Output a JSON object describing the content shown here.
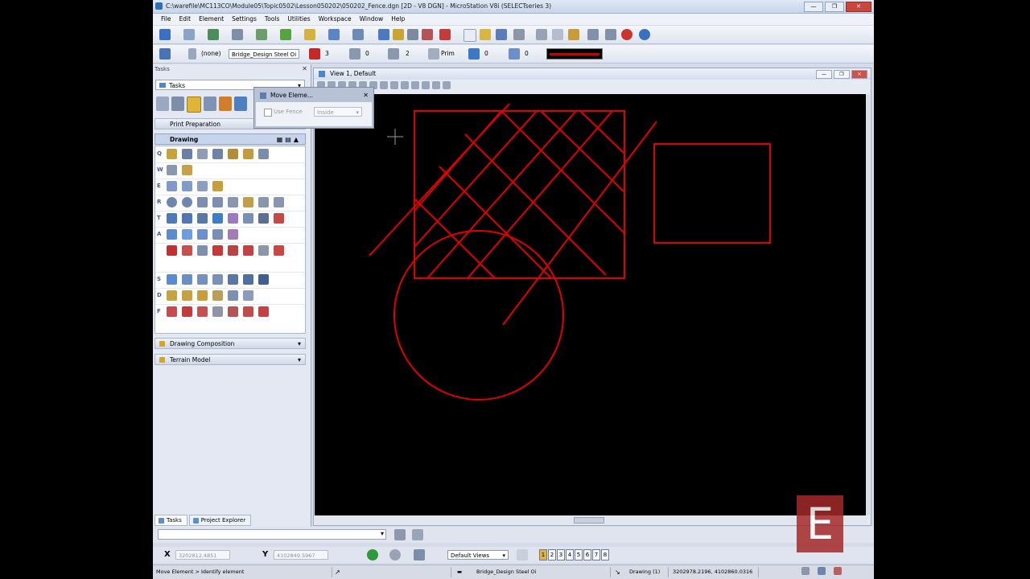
{
  "window": {
    "title": "C:\\warefile\\MC113CO\\Module05\\Topic0502\\Lesson050202\\050202_Fence.dgn [2D - V8 DGN] - MicroStation V8i (SELECTseries 3)",
    "minimize": "—",
    "maximize": "❐",
    "close": "✕"
  },
  "menu": [
    "File",
    "Edit",
    "Element",
    "Settings",
    "Tools",
    "Utilities",
    "Workspace",
    "Window",
    "Help"
  ],
  "attributes": {
    "linestyle": "(none)",
    "level": "Bridge_Design Steel Oi",
    "color": "3",
    "weight_style": "0",
    "weight": "2",
    "class": "Prim",
    "transparency": "0",
    "priority": "0",
    "active_color_hex": "#cc0000"
  },
  "panel": {
    "header": "Tasks",
    "pin": "⊞",
    "close": "✕",
    "task_selector": "Tasks",
    "print_preparation": "Print Preparation",
    "drawing": "Drawing",
    "drawing_composition": "Drawing Composition",
    "terrain_model": "Terrain Model",
    "row_letters": [
      "Q",
      "W",
      "E",
      "R",
      "T",
      "A",
      "",
      "S",
      "D",
      "F"
    ],
    "tab_tasks": "Tasks",
    "tab_explorer": "Project Explorer"
  },
  "view": {
    "title": "View 1, Default",
    "min": "—",
    "max": "❐",
    "close": "✕",
    "background": "#000000",
    "element_color": "#e00000"
  },
  "tool_settings": {
    "title": "Move Eleme...",
    "close": "✕",
    "use_fence_label": "Use Fence",
    "fence_mode": "Inside"
  },
  "coords": {
    "x_label": "X",
    "x_value": "3202812.4851",
    "y_label": "Y",
    "y_value": "4102849.5967",
    "views_dropdown": "Default Views",
    "view_numbers": [
      "1",
      "2",
      "3",
      "4",
      "5",
      "6",
      "7",
      "8"
    ]
  },
  "status": {
    "prompt": "Move Element > Identify element",
    "level": "Bridge_Design Steel Oi",
    "selection": "Drawing (1)",
    "cursor_xy": "3202978.2196, 4102860.0316"
  },
  "watermark": "E"
}
